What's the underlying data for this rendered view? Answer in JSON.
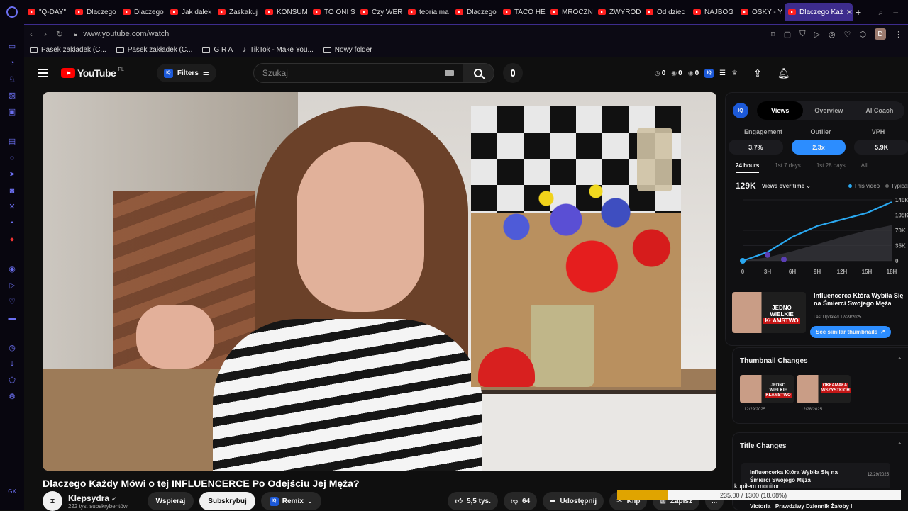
{
  "browser": {
    "tabs": [
      "\"Q-DAY\"",
      "Dlaczego",
      "Dlaczego",
      "Jak dalek",
      "Zaskakuj",
      "KONSUM",
      "TO ONI S",
      "Czy WER",
      "teoria ma",
      "Dlaczego",
      "TACO HE",
      "MROCZN",
      "ZWYROD",
      "Od dziec",
      "NAJBOG",
      "OSKY - Y"
    ],
    "active_tab": "Dlaczego Każ",
    "url": "www.youtube.com/watch",
    "bookmarks": [
      "Pasek zakładek (C...",
      "Pasek zakładek (C...",
      "G R A",
      "TikTok - Make You...",
      "Nowy folder"
    ],
    "profile_initial": "D",
    "sidebar_bottom_text": "GX"
  },
  "youtube": {
    "logo_text": "YouTube",
    "region": "PL",
    "filters_label": "Filters",
    "iq_text": "IQ",
    "search_placeholder": "Szukaj",
    "header_stats": [
      "0",
      "0",
      "0"
    ]
  },
  "video": {
    "title": "Dlaczego Każdy Mówi o tej INFLUENCERCE Po Odejściu Jej Męża?",
    "channel": "Klepsydra",
    "subscribers": "222 tys. subskrybentów",
    "support_label": "Wspieraj",
    "subscribe_label": "Subskrybuj",
    "remix_label": "Remix",
    "likes": "5,5 tys.",
    "dislikes": "64",
    "share_label": "Udostępnij",
    "clip_label": "Klip",
    "save_label": "Zapisz",
    "more_label": "..."
  },
  "iq_panel": {
    "tabs": [
      "Views",
      "Overview",
      "AI Coach"
    ],
    "active_tab": "Views",
    "metrics": [
      {
        "label": "Engagement",
        "value": "3.7%"
      },
      {
        "label": "Outlier",
        "value": "2.3x"
      },
      {
        "label": "VPH",
        "value": "5.9K"
      }
    ],
    "active_metric": "Outlier",
    "ranges": [
      "24 hours",
      "1st 7 days",
      "1st 28 days",
      "All"
    ],
    "active_range": "24 hours",
    "views_total": "129K",
    "views_mode": "Views over time",
    "legend": [
      "This video",
      "Typical"
    ],
    "colors": {
      "this_video": "#2aa8f0",
      "typical": "#5a5a5a",
      "accent": "#2c8dff"
    }
  },
  "chart_data": {
    "type": "area",
    "x": [
      "0",
      "3H",
      "6H",
      "9H",
      "12H",
      "15H",
      "18H"
    ],
    "yticks": [
      "0",
      "35K",
      "70K",
      "105K",
      "140K"
    ],
    "ylim": [
      0,
      140000
    ],
    "series": [
      {
        "name": "This video",
        "values": [
          0,
          20000,
          55000,
          80000,
          95000,
          110000,
          135000
        ]
      },
      {
        "name": "Typical",
        "values": [
          0,
          8000,
          22000,
          38000,
          55000,
          70000,
          82000
        ]
      }
    ]
  },
  "thumbnail_card": {
    "title": "Influencerca Która Wybiła Się na Śmierci Swojego Męża",
    "updated": "Last Updated 12/29/2025",
    "button": "See similar thumbnails",
    "thumb_text_top": "JEDNO WIELKIE",
    "thumb_text_bottom": "KŁAMSTWO"
  },
  "thumbnail_changes": {
    "heading": "Thumbnail Changes",
    "items": [
      {
        "top": "JEDNO WIELKIE",
        "bottom": "KŁAMSTWO",
        "date": "12/29/2025"
      },
      {
        "top": "OKŁAMAŁA",
        "bottom": "WSZYSTKICH",
        "date": "12/28/2025"
      }
    ]
  },
  "title_changes": {
    "heading": "Title Changes",
    "items": [
      {
        "text": "Influencerka Która Wybiła Się na Śmierci Swojego Męża",
        "date": "12/29/2025"
      },
      {
        "text": "Victoria | Prawdziwy Dziennik Żałoby I",
        "date": ""
      }
    ]
  },
  "download_overlay": {
    "label": "kupiłem monitor",
    "progress_text": "235.00 / 1300 (18.08%)",
    "progress": 0.1808
  }
}
